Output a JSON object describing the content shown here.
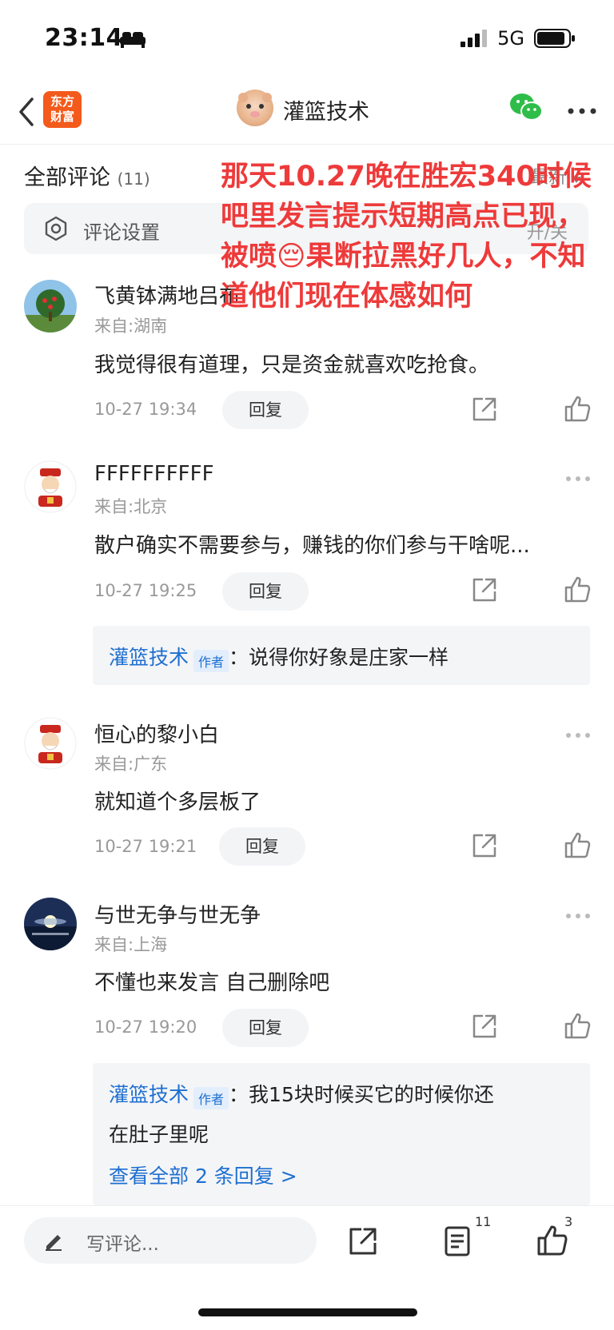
{
  "status": {
    "time": "23:14",
    "network": "5G"
  },
  "nav": {
    "logo_line1": "东方",
    "logo_line2": "财富",
    "title": "灌篮技术"
  },
  "comments_header": {
    "title": "全部评论",
    "count": "(11)",
    "sort": "最新"
  },
  "settings": {
    "label": "评论设置",
    "right": "开/关"
  },
  "overlay": {
    "text": "那天10.27晚在胜宏340时候吧里发言提示短期高点已现，被喷😔果断拉黑好几人，不知道他们现在体感如何"
  },
  "comments": [
    {
      "user": "飞黄钵满地吕布",
      "loc": "来自:湖南",
      "text": "我觉得很有道理，只是资金就喜欢吃抢食。",
      "time": "10-27 19:34",
      "reply_label": "回复"
    },
    {
      "user": "FFFFFFFFFF",
      "loc": "来自:北京",
      "text": "散户确实不需要参与，赚钱的你们参与干啥呢...",
      "time": "10-27 19:25",
      "reply_label": "回复",
      "reply": {
        "author": "灌篮技术",
        "tag": "作者",
        "sep": "：",
        "text": "说得你好象是庄家一样"
      }
    },
    {
      "user": "恒心的黎小白",
      "loc": "来自:广东",
      "text": "就知道个多层板了",
      "time": "10-27 19:21",
      "reply_label": "回复"
    },
    {
      "user": "与世无争与世无争",
      "loc": "来自:上海",
      "text": "不懂也来发言 自己删除吧",
      "time": "10-27 19:20",
      "reply_label": "回复",
      "reply": {
        "author": "灌篮技术",
        "tag": "作者",
        "sep": "：",
        "text_line1": "我15块时候买它的时候你还",
        "text_line2": "在肚子里呢",
        "more": "查看全部 2 条回复 >"
      }
    }
  ],
  "bottom": {
    "write_placeholder": "写评论...",
    "comment_badge": "11",
    "like_badge": "3"
  },
  "colors": {
    "brand": "#f35a1b",
    "link": "#1e6fd0",
    "overlay": "#ee3a3a"
  }
}
